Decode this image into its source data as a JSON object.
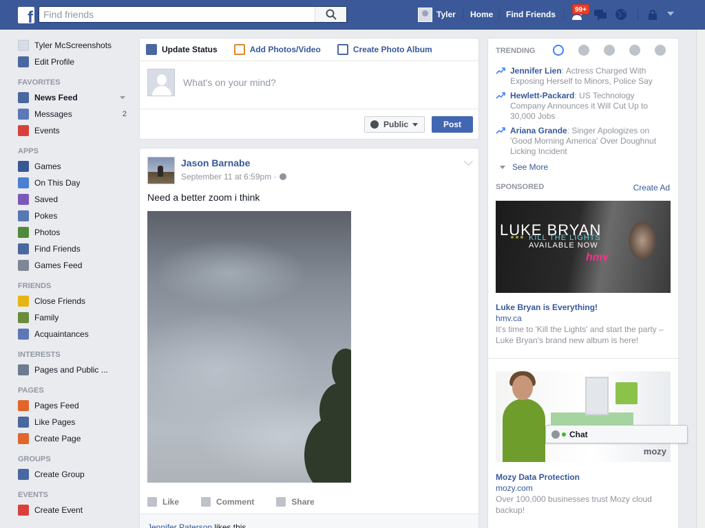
{
  "topbar": {
    "search_placeholder": "Find friends",
    "user_name": "Tyler",
    "home_label": "Home",
    "find_friends_label": "Find Friends",
    "friend_requests_badge": "99+"
  },
  "leftnav": {
    "profile_name": "Tyler McScreenshots",
    "edit_profile": "Edit Profile",
    "favorites_head": "FAVORITES",
    "favorites": [
      {
        "label": "News Feed",
        "icon": "news-feed-icon",
        "color": "#4b67a1"
      },
      {
        "label": "Messages",
        "icon": "messages-icon",
        "color": "#5b78b8",
        "count": "2"
      },
      {
        "label": "Events",
        "icon": "events-icon",
        "color": "#d9403b"
      }
    ],
    "apps_head": "APPS",
    "apps": [
      {
        "label": "Games",
        "icon": "games-icon",
        "color": "#3a5795"
      },
      {
        "label": "On This Day",
        "icon": "on-this-day-icon",
        "color": "#4a7fd4"
      },
      {
        "label": "Saved",
        "icon": "saved-icon",
        "color": "#7a5ab9"
      },
      {
        "label": "Pokes",
        "icon": "pokes-icon",
        "color": "#5878b3"
      },
      {
        "label": "Photos",
        "icon": "photos-icon",
        "color": "#4f8a3c"
      },
      {
        "label": "Find Friends",
        "icon": "find-friends-icon",
        "color": "#4b67a1"
      },
      {
        "label": "Games Feed",
        "icon": "games-feed-icon",
        "color": "#7f8695"
      }
    ],
    "friends_head": "FRIENDS",
    "friends": [
      {
        "label": "Close Friends",
        "icon": "star-icon",
        "color": "#e7b416"
      },
      {
        "label": "Family",
        "icon": "family-icon",
        "color": "#6a8c3b"
      },
      {
        "label": "Acquaintances",
        "icon": "acquaintances-icon",
        "color": "#5b78b8"
      }
    ],
    "interests_head": "INTERESTS",
    "interests": [
      {
        "label": "Pages and Public ...",
        "icon": "pages-list-icon",
        "color": "#6d7a91"
      }
    ],
    "pages_head": "PAGES",
    "pages": [
      {
        "label": "Pages Feed",
        "icon": "pages-feed-icon",
        "color": "#e0672b"
      },
      {
        "label": "Like Pages",
        "icon": "like-pages-icon",
        "color": "#4b67a1"
      },
      {
        "label": "Create Page",
        "icon": "create-page-icon",
        "color": "#e0672b"
      }
    ],
    "groups_head": "GROUPS",
    "groups": [
      {
        "label": "Create Group",
        "icon": "create-group-icon",
        "color": "#4b67a1"
      }
    ],
    "events_head": "EVENTS",
    "events": [
      {
        "label": "Create Event",
        "icon": "create-event-icon",
        "color": "#d9403b"
      }
    ]
  },
  "composer": {
    "tab_status": "Update Status",
    "tab_photos": "Add Photos/Video",
    "tab_album": "Create Photo Album",
    "placeholder": "What's on your mind?",
    "privacy": "Public",
    "post": "Post"
  },
  "post": {
    "author": "Jason Barnabe",
    "time": "September 11 at 6:59pm · ",
    "text": "Need a better zoom i think",
    "like": "Like",
    "comment": "Comment",
    "share": "Share",
    "liker": "Jennifer Paterson",
    "likes_suffix": " likes this."
  },
  "trending": {
    "head": "TRENDING",
    "items": [
      {
        "name": "Jennifer Lien",
        "text": ": Actress Charged With Exposing Herself to Minors, Police Say"
      },
      {
        "name": "Hewlett-Packard",
        "text": ": US Technology Company Announces it Will Cut Up to 30,000 Jobs"
      },
      {
        "name": "Ariana Grande",
        "text": ": Singer Apologizes on 'Good Morning America' Over Doughnut Licking Incident"
      }
    ],
    "see_more": "See More"
  },
  "sponsored": {
    "head": "SPONSORED",
    "create_ad": "Create Ad",
    "ads": [
      {
        "img_line1": "LUKE BRYAN",
        "img_line2": "KILL THE LIGHTS",
        "img_line3": "AVAILABLE NOW",
        "img_brand": "hmv",
        "title": "Luke Bryan is Everything!",
        "domain": "hmv.ca",
        "desc": "It's time to 'Kill the Lights' and start the party – Luke Bryan's brand new album is here!"
      },
      {
        "img_brand": "mozy",
        "title": "Mozy Data Protection",
        "domain": "mozy.com",
        "desc": "Over 100,000 businesses trust Mozy cloud backup!"
      }
    ]
  },
  "chat": {
    "label": "Chat"
  },
  "colors": {
    "brand": "#3b5998",
    "link": "#365899",
    "post_button": "#4267b2",
    "badge": "#f03d25"
  }
}
